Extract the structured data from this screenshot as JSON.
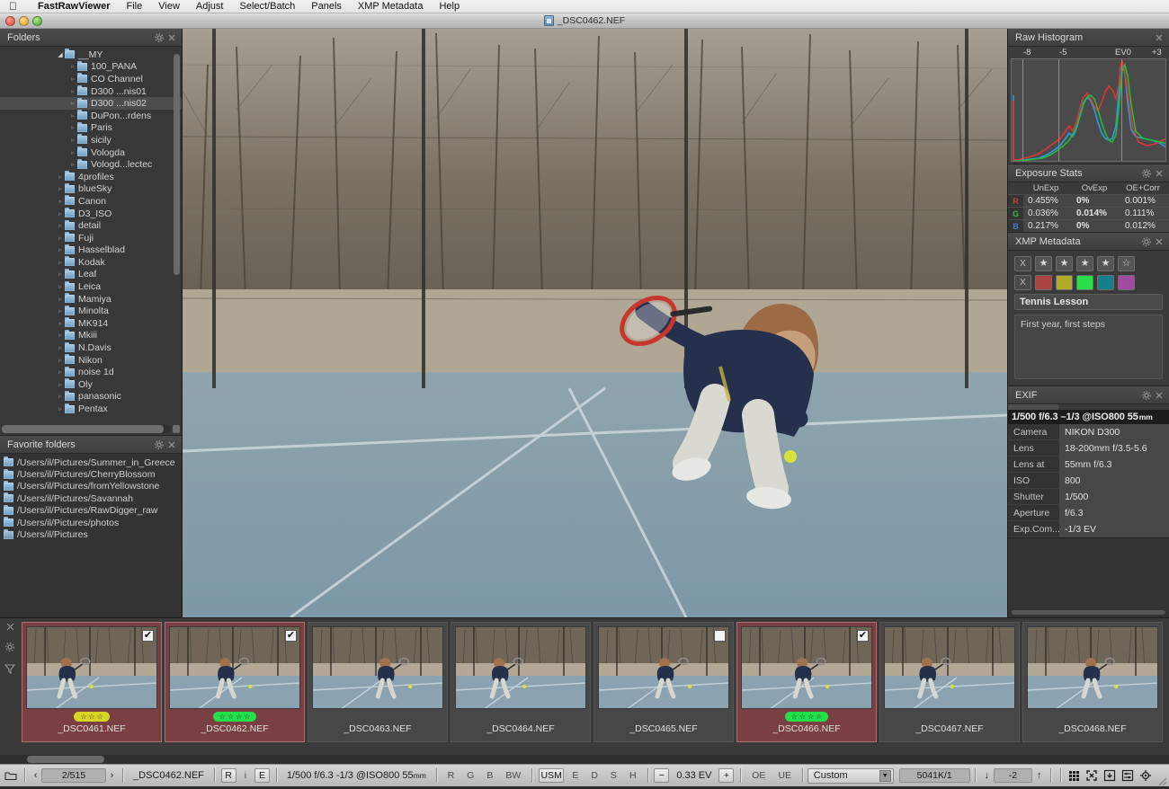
{
  "menubar": {
    "apple": "apple-logo",
    "app": "FastRawViewer",
    "items": [
      "File",
      "View",
      "Adjust",
      "Select/Batch",
      "Panels",
      "XMP Metadata",
      "Help"
    ]
  },
  "window": {
    "title": "_DSC0462.NEF"
  },
  "folders_panel": {
    "title": "Folders",
    "tree": [
      {
        "label": "__MY",
        "depth": 1,
        "arrow": "open",
        "selected": false
      },
      {
        "label": "100_PANA",
        "depth": 2,
        "arrow": "closed",
        "selected": false
      },
      {
        "label": "CO Channel",
        "depth": 2,
        "arrow": "closed",
        "selected": false
      },
      {
        "label": "D300 ...nis01",
        "depth": 2,
        "arrow": "closed",
        "selected": false
      },
      {
        "label": "D300 ...nis02",
        "depth": 2,
        "arrow": "closed",
        "selected": true
      },
      {
        "label": "DuPon...rdens",
        "depth": 2,
        "arrow": "closed",
        "selected": false
      },
      {
        "label": "Paris",
        "depth": 2,
        "arrow": "closed",
        "selected": false
      },
      {
        "label": "sicily",
        "depth": 2,
        "arrow": "closed",
        "selected": false
      },
      {
        "label": "Vologda",
        "depth": 2,
        "arrow": "closed",
        "selected": false
      },
      {
        "label": "Vologd...lectec",
        "depth": 2,
        "arrow": "closed",
        "selected": false
      },
      {
        "label": "4profiles",
        "depth": 1,
        "arrow": "closed",
        "selected": false
      },
      {
        "label": "blueSky",
        "depth": 1,
        "arrow": "closed",
        "selected": false
      },
      {
        "label": "Canon",
        "depth": 1,
        "arrow": "closed",
        "selected": false
      },
      {
        "label": "D3_ISO",
        "depth": 1,
        "arrow": "closed",
        "selected": false
      },
      {
        "label": "detail",
        "depth": 1,
        "arrow": "closed",
        "selected": false
      },
      {
        "label": "Fuji",
        "depth": 1,
        "arrow": "closed",
        "selected": false
      },
      {
        "label": "Hasselblad",
        "depth": 1,
        "arrow": "closed",
        "selected": false
      },
      {
        "label": "Kodak",
        "depth": 1,
        "arrow": "closed",
        "selected": false
      },
      {
        "label": "Leaf",
        "depth": 1,
        "arrow": "closed",
        "selected": false
      },
      {
        "label": "Leica",
        "depth": 1,
        "arrow": "closed",
        "selected": false
      },
      {
        "label": "Mamiya",
        "depth": 1,
        "arrow": "closed",
        "selected": false
      },
      {
        "label": "Minolta",
        "depth": 1,
        "arrow": "closed",
        "selected": false
      },
      {
        "label": "MK914",
        "depth": 1,
        "arrow": "closed",
        "selected": false
      },
      {
        "label": "Mkiii",
        "depth": 1,
        "arrow": "closed",
        "selected": false
      },
      {
        "label": "N.Davis",
        "depth": 1,
        "arrow": "closed",
        "selected": false
      },
      {
        "label": "Nikon",
        "depth": 1,
        "arrow": "closed",
        "selected": false
      },
      {
        "label": "noise 1d",
        "depth": 1,
        "arrow": "closed",
        "selected": false
      },
      {
        "label": "Oly",
        "depth": 1,
        "arrow": "closed",
        "selected": false
      },
      {
        "label": "panasonic",
        "depth": 1,
        "arrow": "closed",
        "selected": false
      },
      {
        "label": "Pentax",
        "depth": 1,
        "arrow": "closed",
        "selected": false
      }
    ]
  },
  "favorites_panel": {
    "title": "Favorite folders",
    "items": [
      {
        "label": "/Users/il/Pictures/Summer_in_Greece",
        "home": false
      },
      {
        "label": "/Users/il/Pictures/CherryBlossom",
        "home": false
      },
      {
        "label": "/Users/il/Pictures/fromYellowstone",
        "home": false
      },
      {
        "label": "/Users/il/Pictures/Savannah",
        "home": false
      },
      {
        "label": "/Users/il/Pictures/RawDigger_raw",
        "home": false
      },
      {
        "label": "/Users/il/Pictures/photos",
        "home": false
      },
      {
        "label": "/Users/il/Pictures",
        "home": true
      }
    ]
  },
  "histogram_panel": {
    "title": "Raw Histogram",
    "axis_labels": [
      "-8",
      "-5",
      "EV0",
      "+3"
    ],
    "channels": [
      "R",
      "G",
      "B"
    ],
    "colors": {
      "r": "#e03434",
      "g": "#22bb3a",
      "b": "#2e9ae0"
    }
  },
  "exposure_stats": {
    "title": "Exposure Stats",
    "columns": [
      "UnExp",
      "OvExp",
      "OE+Corr"
    ],
    "rows": [
      {
        "channel": "R",
        "unexp": "0.455%",
        "ovexp": "0%",
        "oecorr": "0.001%",
        "bold": true
      },
      {
        "channel": "G",
        "unexp": "0.036%",
        "ovexp": "0.014%",
        "oecorr": "0.111%",
        "bold": true
      },
      {
        "channel": "B",
        "unexp": "0.217%",
        "ovexp": "0%",
        "oecorr": "0.012%",
        "bold": true
      }
    ]
  },
  "xmp_panel": {
    "title": "XMP Metadata",
    "reject_label": "X",
    "stars": [
      {
        "filled": true
      },
      {
        "filled": true
      },
      {
        "filled": true
      },
      {
        "filled": true
      },
      {
        "filled": false
      }
    ],
    "colors": [
      {
        "hex": "#a94442",
        "selected": false
      },
      {
        "hex": "#b3ab28",
        "selected": false
      },
      {
        "hex": "#2ae04a",
        "selected": true
      },
      {
        "hex": "#14808c",
        "selected": false
      },
      {
        "hex": "#a04aa0",
        "selected": false
      }
    ],
    "title_field": "Tennis Lesson",
    "description_field": "First year, first steps"
  },
  "exif_panel": {
    "title": "EXIF",
    "summary": "1/500 f/6.3 –1/3 @ISO800 55",
    "summary_unit": "mm",
    "rows": [
      {
        "key": "Camera",
        "value": "NIKON D300"
      },
      {
        "key": "Lens",
        "value": "18-200mm f/3.5-5.6"
      },
      {
        "key": "Lens at",
        "value": "55mm f/6.3"
      },
      {
        "key": "ISO",
        "value": "800"
      },
      {
        "key": "Shutter",
        "value": "1/500"
      },
      {
        "key": "Aperture",
        "value": "f/6.3"
      },
      {
        "key": "Exp.Com...",
        "value": "-1/3 EV"
      }
    ]
  },
  "filmstrip": {
    "side_icons": [
      "close-icon",
      "gear-icon",
      "filter-icon"
    ],
    "thumbs": [
      {
        "name": "_DSC0461.NEF",
        "selected": true,
        "checked": true,
        "checkbox": true,
        "rating": {
          "stars": 3,
          "color": "yellow"
        }
      },
      {
        "name": "_DSC0462.NEF",
        "selected": true,
        "checked": true,
        "checkbox": true,
        "rating": {
          "stars": 4,
          "color": "green"
        }
      },
      {
        "name": "_DSC0463.NEF",
        "selected": false,
        "checked": false,
        "checkbox": false,
        "rating": null
      },
      {
        "name": "_DSC0464.NEF",
        "selected": false,
        "checked": false,
        "checkbox": false,
        "rating": null
      },
      {
        "name": "_DSC0465.NEF",
        "selected": false,
        "checked": false,
        "checkbox": true,
        "rating": null
      },
      {
        "name": "_DSC0466.NEF",
        "selected": true,
        "checked": true,
        "checkbox": true,
        "rating": {
          "stars": 4,
          "color": "green"
        }
      },
      {
        "name": "_DSC0467.NEF",
        "selected": false,
        "checked": false,
        "checkbox": false,
        "rating": null
      },
      {
        "name": "_DSC0468.NEF",
        "selected": false,
        "checked": false,
        "checkbox": false,
        "rating": null
      }
    ]
  },
  "statusbar": {
    "folder_icon": "folder-icon",
    "prev_arrow": "‹",
    "counter": "2/515",
    "next_arrow": "›",
    "filename": "_DSC0462.NEF",
    "mode_buttons": [
      "R",
      "i",
      "E"
    ],
    "exif_line": "1/500 f/6.3 -1/3 @ISO800 55",
    "exif_unit": "mm",
    "channel_buttons": [
      "R",
      "G",
      "B",
      "BW"
    ],
    "sharpen_buttons": [
      "USM",
      "E",
      "D",
      "S",
      "H"
    ],
    "ev_minus": "−",
    "ev_value": "0.33 EV",
    "ev_plus": "+",
    "oe_ue_buttons": [
      "OE",
      "UE"
    ],
    "profile_select": "Custom",
    "temperature": "5041K/1",
    "down_arrow": "↓",
    "contrast_value": "-2",
    "up_arrow": "↑",
    "right_icons": [
      "grid-icon",
      "fit-screen-icon",
      "download-icon",
      "sliders-icon",
      "target-icon"
    ]
  }
}
